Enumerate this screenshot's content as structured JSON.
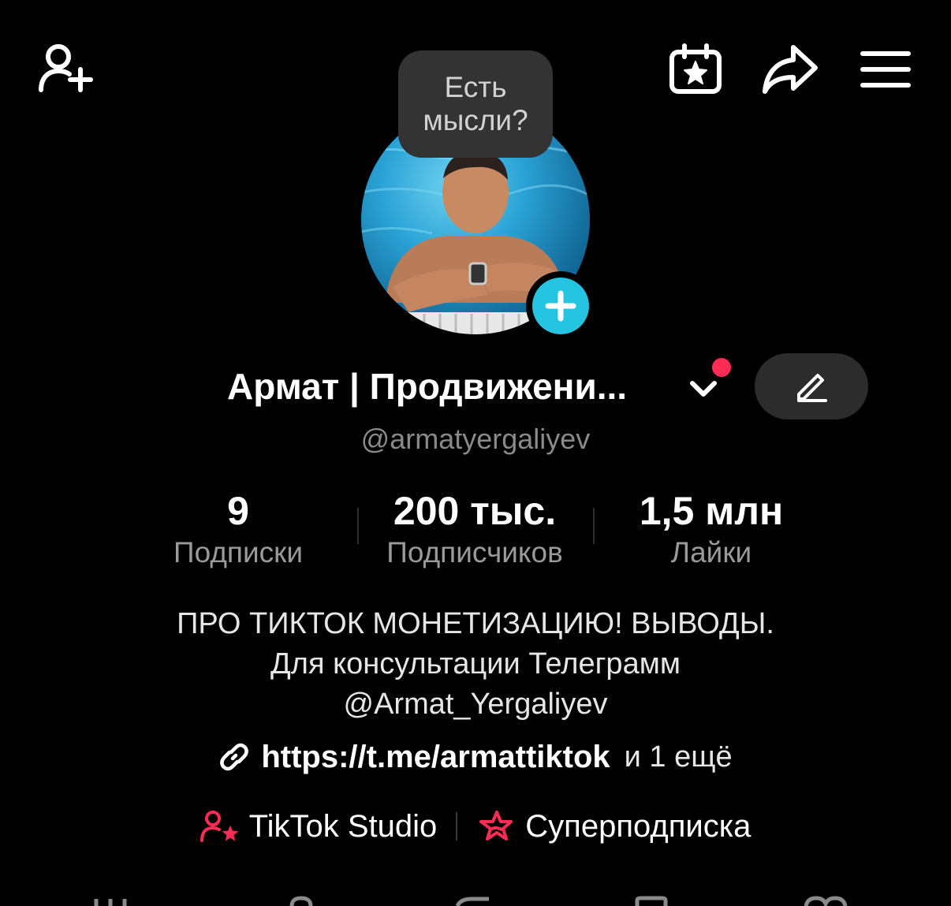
{
  "header": {
    "icons": [
      "add-friend-icon",
      "calendar-star-icon",
      "share-icon",
      "menu-icon"
    ]
  },
  "bubble": {
    "line1": "Есть",
    "line2": "мысли?"
  },
  "profile": {
    "name": "Армат | Продвижени...",
    "handle": "@armatyergaliyev",
    "colors": {
      "accent": "#fe2c55",
      "add_button": "#25c4e0"
    }
  },
  "stats": [
    {
      "value": "9",
      "label": "Подписки"
    },
    {
      "value": "200 тыс.",
      "label": "Подписчиков"
    },
    {
      "value": "1,5 млн",
      "label": "Лайки"
    }
  ],
  "bio": {
    "line1": "ПРО ТИКТОК МОНЕТИЗАЦИЮ! ВЫВОДЫ.",
    "line2": "Для консультации Телеграмм",
    "line3": "@Armat_Yergaliyev"
  },
  "link": {
    "url": "https://t.me/armattiktok",
    "more": "и 1 ещё"
  },
  "tools": {
    "studio": "TikTok Studio",
    "subscription": "Суперподписка"
  }
}
